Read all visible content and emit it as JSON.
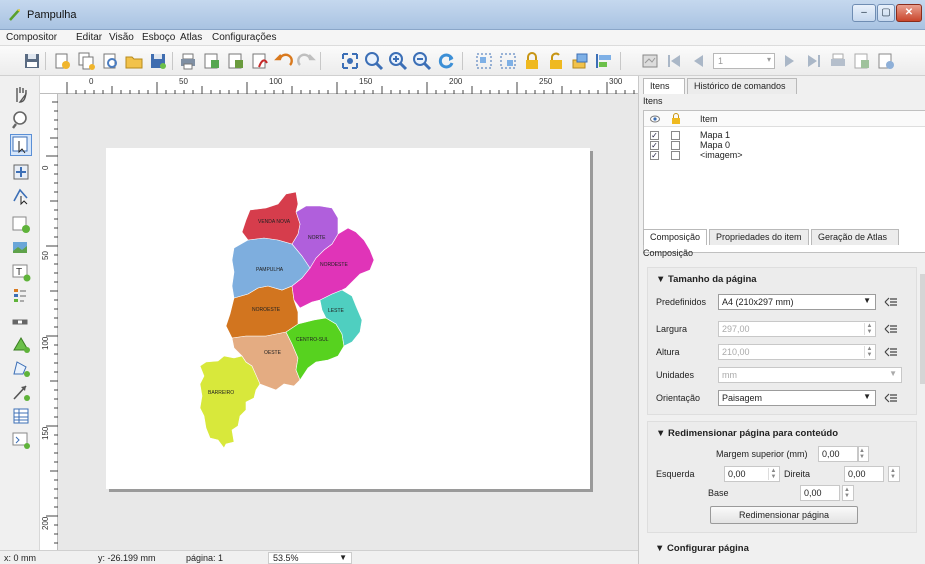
{
  "window": {
    "title": "Pampulha",
    "buttons": [
      "–",
      "▢",
      "✕"
    ]
  },
  "menu": [
    "Compositor",
    "Editar",
    "Visão",
    "Esboço",
    "Atlas",
    "Configurações"
  ],
  "toolbar": {
    "page_field_value": "1"
  },
  "ruler": {
    "h_labels": [
      "0",
      "50",
      "100",
      "150",
      "200",
      "250",
      "300"
    ],
    "v_labels": [
      "0",
      "50",
      "100",
      "150",
      "200"
    ]
  },
  "map": {
    "regions": [
      "VENDA NOVA",
      "NORTE",
      "NORDESTE",
      "PAMPULHA",
      "NOROESTE",
      "LESTE",
      "CENTRO-SUL",
      "OESTE",
      "BARREIRO"
    ],
    "colors": {
      "venda_nova": "#d63d4c",
      "norte": "#b05fdc",
      "nordeste": "#e034b8",
      "pampulha": "#7eaede",
      "noroeste": "#d2751f",
      "leste": "#4fcfc0",
      "centro_sul": "#57d21f",
      "oeste": "#e4ac82",
      "barreiro": "#d8e83b"
    }
  },
  "status": {
    "x": "x: 0 mm",
    "y": "y: -26.199 mm",
    "page": "página: 1",
    "zoom": "53.5%"
  },
  "panel": {
    "tabs_top": [
      "Itens",
      "Histórico de comandos"
    ],
    "items_title": "Itens",
    "items_header": "Item",
    "items": [
      {
        "label": "Mapa 1",
        "visible": true
      },
      {
        "label": "Mapa 0",
        "visible": true
      },
      {
        "label": "<imagem>",
        "visible": true
      }
    ],
    "tabs_bottom": [
      "Composição",
      "Propriedades do item",
      "Geração de Atlas"
    ],
    "comp_title": "Composição",
    "page_size": {
      "title": "Tamanho da página",
      "preset_label": "Predefinidos",
      "preset_value": "A4 (210x297 mm)",
      "width_label": "Largura",
      "width_value": "297,00",
      "height_label": "Altura",
      "height_value": "210,00",
      "units_label": "Unidades",
      "units_value": "mm",
      "orientation_label": "Orientação",
      "orientation_value": "Paisagem"
    },
    "resize": {
      "title": "Redimensionar página para conteúdo",
      "top_label": "Margem superior (mm)",
      "top_value": "0,00",
      "left_label": "Esquerda",
      "left_value": "0,00",
      "right_label": "Direita",
      "right_value": "0,00",
      "bottom_label": "Base",
      "bottom_value": "0,00",
      "button": "Redimensionar página"
    },
    "configure": {
      "title": "Configurar página"
    }
  }
}
